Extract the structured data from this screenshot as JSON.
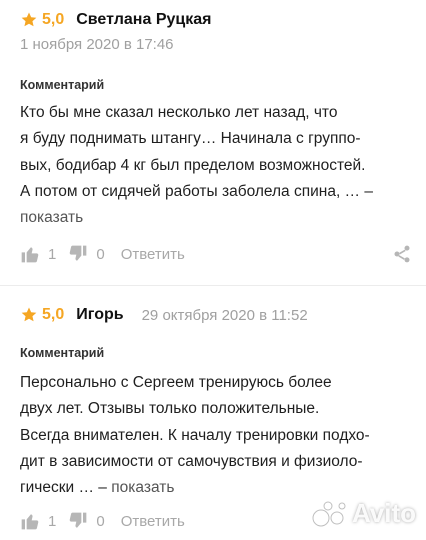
{
  "colors": {
    "star": "#f5a623",
    "muted": "#a0a0a0",
    "text": "#1f1f1f"
  },
  "reviews": [
    {
      "rating": "5,0",
      "author": "Светлана Руцкая",
      "date": "1 ноября 2020 в 17:46",
      "comment_label": "Комментарий",
      "lines": [
        "Кто бы мне сказал несколько лет назад, что",
        "я буду поднимать штангу… Начинала с группо-",
        "вых, бодибар 4 кг был пределом возможностей.",
        "А потом от сидячей работы заболела спина, … –"
      ],
      "show_more": "показать",
      "likes": "1",
      "dislikes": "0",
      "reply": "Ответить",
      "icons": {
        "like": "thumb-up-icon",
        "dislike": "thumb-down-icon",
        "share": "share-icon"
      }
    },
    {
      "rating": "5,0",
      "author": "Игорь",
      "date": "29 октября 2020 в 11:52",
      "comment_label": "Комментарий",
      "lines": [
        "Персонально с Сергеем тренируюсь более",
        "двух лет. Отзывы только положительные.",
        "Всегда внимателен. К началу тренировки подхо-",
        "дит в зависимости от самочувствия и физиоло-",
        "гически … –"
      ],
      "show_more": "показать",
      "likes": "1",
      "dislikes": "0",
      "reply": "Ответить",
      "icons": {
        "like": "thumb-up-icon",
        "dislike": "thumb-down-icon",
        "share": "share-icon"
      }
    }
  ],
  "watermark": "Avito"
}
